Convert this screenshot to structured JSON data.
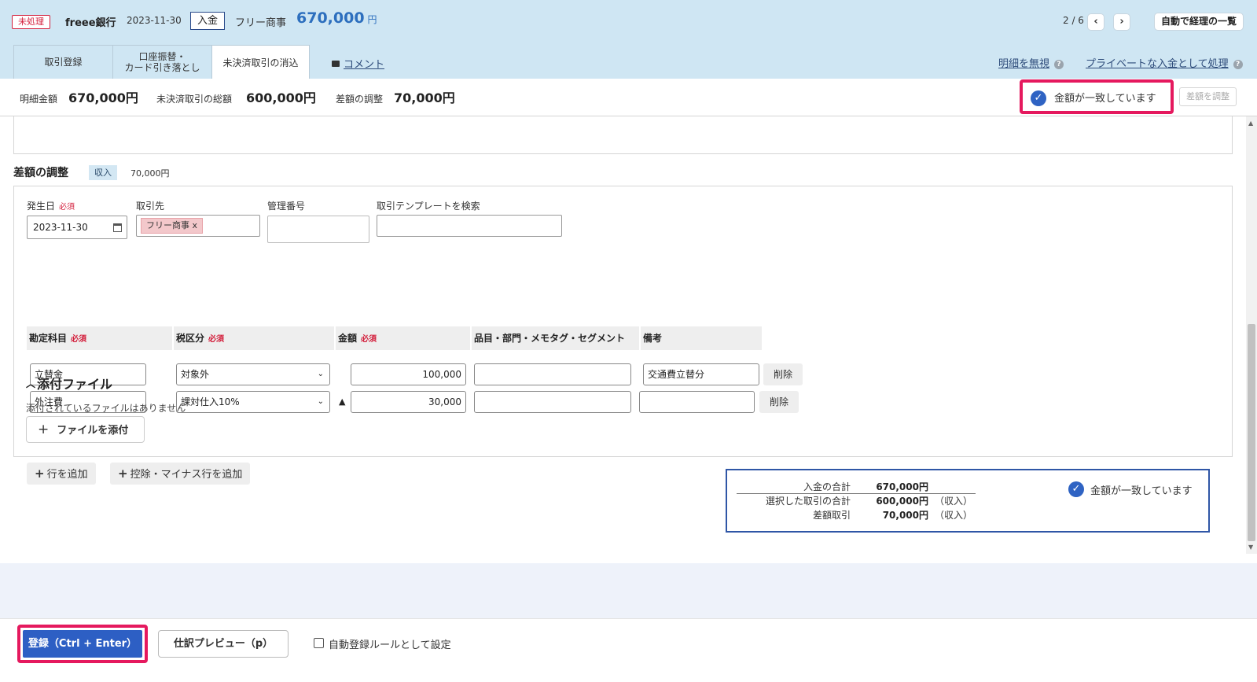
{
  "header": {
    "status": "未処理",
    "bank": "freee銀行",
    "date": "2023-11-30",
    "direction": "入金",
    "partner": "フリー商事",
    "amount": "670,000",
    "amount_unit": "円",
    "pager": "2 / 6",
    "prev_icon": "chevron-left-icon",
    "next_icon": "chevron-right-icon",
    "list_button": "自動で経理の一覧",
    "tabs": [
      {
        "line1": "取引登録",
        "line2": ""
      },
      {
        "line1": "口座振替・",
        "line2": "カード引き落とし"
      },
      {
        "line1": "未決済取引の消込",
        "line2": ""
      }
    ],
    "comment_link": "コメント",
    "ignore_link": "明細を無視",
    "private_link": "プライベートな入金として処理"
  },
  "summary": {
    "detail_label": "明細金額",
    "detail_value": "670,000円",
    "unsettled_label": "未決済取引の総額",
    "unsettled_value": "600,000円",
    "diff_label": "差額の調整",
    "diff_value": "70,000円",
    "match_text": "金額が一致しています",
    "adjust_button": "差額を調整"
  },
  "adjust": {
    "title": "差額の調整",
    "badge": "収入",
    "amount": "70,000円",
    "required": "必須",
    "date_label": "発生日",
    "date_value": "2023-11-30",
    "partner_label": "取引先",
    "partner_chip": "フリー商事 x",
    "mgmt_label": "管理番号",
    "mgmt_value": "",
    "template_label": "取引テンプレートを検索",
    "template_value": "",
    "columns": {
      "account": "勘定科目",
      "tax": "税区分",
      "amount": "金額",
      "item": "品目・部門・メモタグ・セグメント",
      "note": "備考"
    },
    "rows": [
      {
        "account": "立替金",
        "tax": "対象外",
        "minus": "",
        "amount": "100,000",
        "item": "",
        "note": "交通費立替分",
        "delete": "削除"
      },
      {
        "account": "外注費",
        "tax": "課対仕入10%",
        "minus": "▲",
        "amount": "30,000",
        "item": "",
        "note": "",
        "delete": "削除"
      }
    ],
    "add_row": "行を追加",
    "add_minus_row": "控除・マイナス行を追加",
    "plus_symbol": "+"
  },
  "attachments": {
    "title": "添付ファイル",
    "toggle_icon": "chevron-up-icon",
    "empty_text": "添付されているファイルはありません",
    "add_button": "ファイルを添付"
  },
  "totals": {
    "rows": [
      {
        "label": "入金の合計",
        "value": "670,000円",
        "note": ""
      },
      {
        "label": "選択した取引の合計",
        "value": "600,000円",
        "note": "（収入）"
      },
      {
        "label": "差額取引",
        "value": "70,000円",
        "note": "（収入）"
      }
    ],
    "match_text": "金額が一致しています"
  },
  "footer": {
    "submit": "登録（Ctrl + Enter）",
    "preview": "仕訳プレビュー（p）",
    "rule_checkbox": "自動登録ルールとして設定",
    "rule_checked": false
  },
  "colors": {
    "header_bg": "#cfe6f3",
    "accent_blue": "#2d5fc4",
    "highlight_pink": "#e5195e",
    "required_red": "#d31f3c"
  }
}
